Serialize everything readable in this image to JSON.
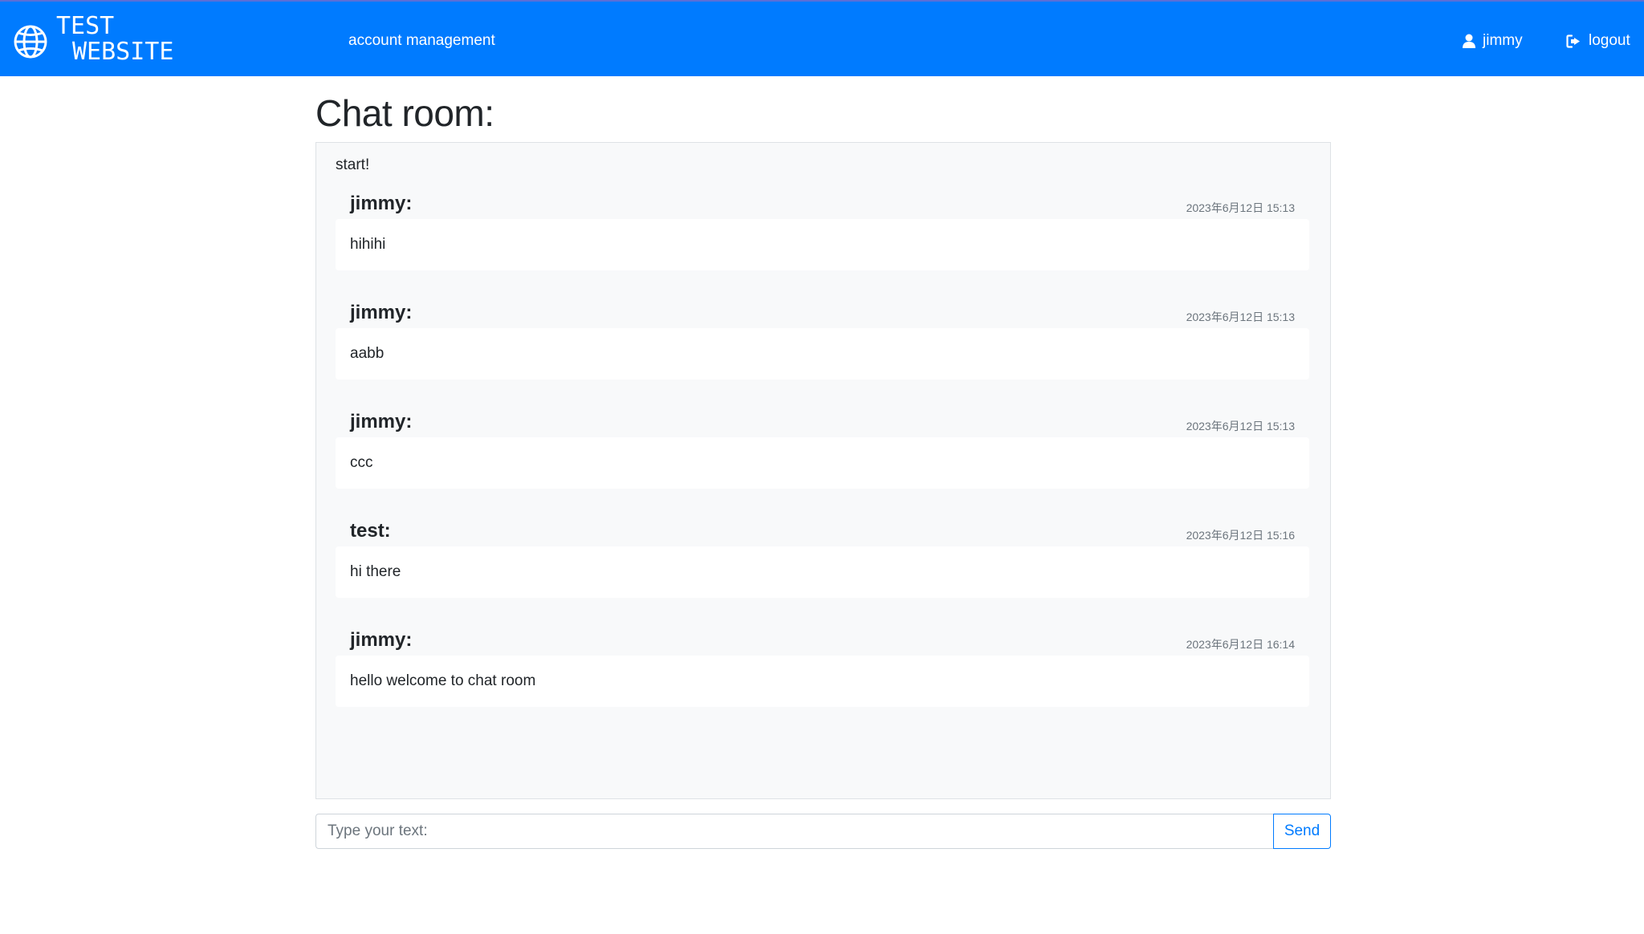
{
  "header": {
    "brand_line1": "TEST",
    "brand_line2": "WEBSITE",
    "nav_account": "account management",
    "nav_user": "jimmy",
    "nav_logout": "logout",
    "icons": {
      "brand": "globe-icon",
      "user": "user-icon",
      "logout": "logout-icon"
    }
  },
  "main": {
    "title": "Chat room:",
    "chat_start": "start!",
    "messages": [
      {
        "user": "jimmy:",
        "time": "2023年6月12日 15:13",
        "text": "hihihi"
      },
      {
        "user": "jimmy:",
        "time": "2023年6月12日 15:13",
        "text": "aabb"
      },
      {
        "user": "jimmy:",
        "time": "2023年6月12日 15:13",
        "text": "ccc"
      },
      {
        "user": "test:",
        "time": "2023年6月12日 15:16",
        "text": "hi there"
      },
      {
        "user": "jimmy:",
        "time": "2023年6月12日 16:14",
        "text": "hello welcome to chat room"
      }
    ]
  },
  "composer": {
    "placeholder": "Type your text:",
    "value": "",
    "send_label": "Send"
  },
  "colors": {
    "navbar": "#007bff",
    "chat_background": "#f8f9fa",
    "message_background": "#ffffff",
    "accent": "#007bff"
  }
}
